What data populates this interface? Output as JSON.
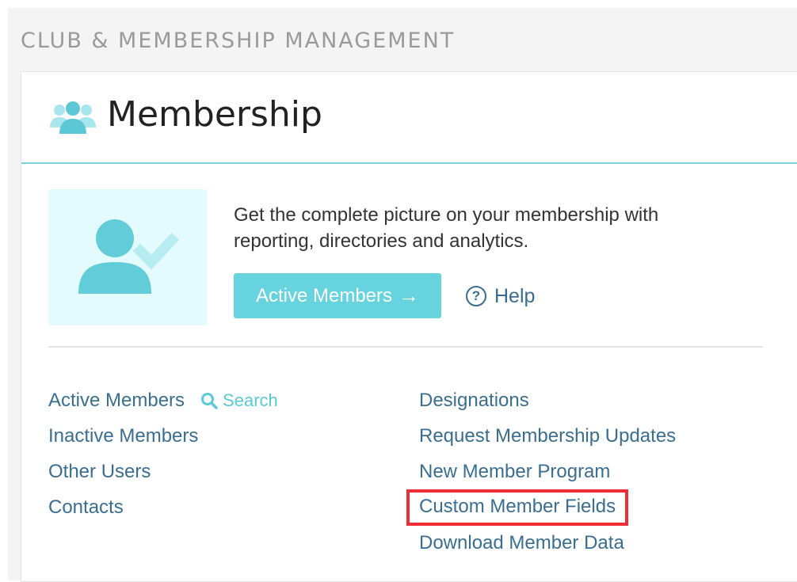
{
  "section": {
    "title": "CLUB & MEMBERSHIP MANAGEMENT"
  },
  "card": {
    "title": "Membership",
    "header_icon": "users-group-icon",
    "promo": {
      "image_icon": "user-check-icon",
      "text": "Get the complete picture on your membership with reporting, directories and analytics.",
      "button_label": "Active Members",
      "button_icon": "arrow-right-icon",
      "help_label": "Help",
      "help_icon": "question-circle-icon"
    },
    "links_left": [
      {
        "label": "Active Members",
        "search_label": "Search"
      },
      {
        "label": "Inactive Members"
      },
      {
        "label": "Other Users"
      },
      {
        "label": "Contacts"
      }
    ],
    "links_right": [
      {
        "label": "Designations"
      },
      {
        "label": "Request Membership Updates"
      },
      {
        "label": "New Member Program"
      },
      {
        "label": "Custom Member Fields",
        "highlighted": true
      },
      {
        "label": "Download Member Data"
      }
    ]
  },
  "colors": {
    "accent": "#67d3de",
    "link": "#3a6e91",
    "highlight": "#ee2d37",
    "promo_bg": "#e4fbfd"
  }
}
